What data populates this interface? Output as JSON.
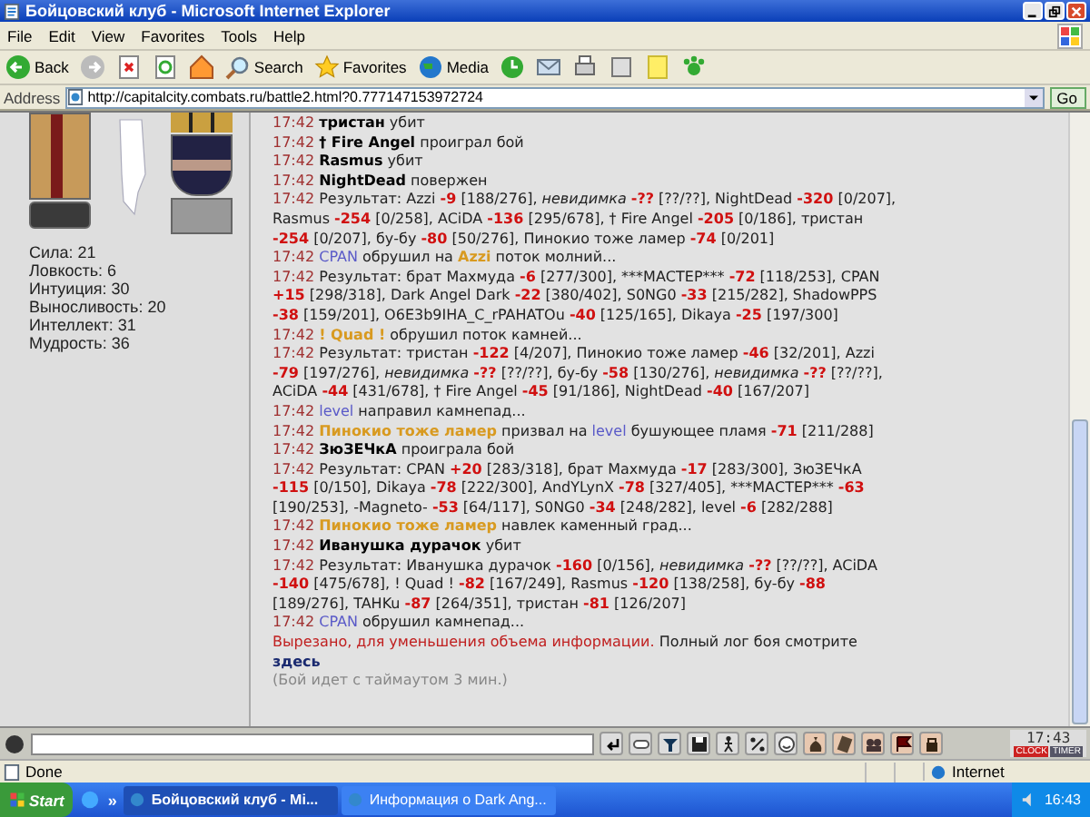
{
  "window": {
    "title": "Бойцовский клуб - Microsoft Internet Explorer"
  },
  "menu": [
    "File",
    "Edit",
    "View",
    "Favorites",
    "Tools",
    "Help"
  ],
  "toolbar": {
    "back": "Back",
    "buttons": [
      {
        "label": "Search",
        "kind": "search"
      },
      {
        "label": "Favorites",
        "kind": "star"
      },
      {
        "label": "Media",
        "kind": "globe"
      }
    ]
  },
  "address": {
    "label": "Address",
    "value": "http://capitalcity.combats.ru/battle2.html?0.777147153972724",
    "go": "Go"
  },
  "character": {
    "stats": [
      "Сила: 21",
      "Ловкость: 6",
      "Интуиция: 30",
      "Выносливость: 20",
      "Интеллект: 31",
      "Мудрость: 36"
    ]
  },
  "log": {
    "entries": [
      {
        "time": "17:42",
        "parts": [
          {
            "kind": "name",
            "text": "тристан"
          },
          {
            "kind": "text",
            "text": " убит"
          }
        ]
      },
      {
        "time": "17:42",
        "parts": [
          {
            "kind": "name",
            "text": "† Fire Angel"
          },
          {
            "kind": "text",
            "text": " проиграл бой"
          }
        ]
      },
      {
        "time": "17:42",
        "parts": [
          {
            "kind": "name",
            "text": "Rasmus"
          },
          {
            "kind": "text",
            "text": " убит"
          }
        ]
      },
      {
        "time": "17:42",
        "parts": [
          {
            "kind": "name",
            "text": "NightDead"
          },
          {
            "kind": "text",
            "text": " повержен"
          }
        ]
      },
      {
        "time": "17:42",
        "parts": [
          {
            "kind": "text",
            "text": "Результат: Azzi "
          },
          {
            "kind": "hit",
            "text": "-9"
          },
          {
            "kind": "text",
            "text": " [188/276], "
          },
          {
            "kind": "italic",
            "text": "невидимка "
          },
          {
            "kind": "hit",
            "text": "-??"
          },
          {
            "kind": "text",
            "text": " [??/??], NightDead "
          },
          {
            "kind": "hit",
            "text": "-320"
          },
          {
            "kind": "text",
            "text": " [0/207], Rasmus "
          },
          {
            "kind": "hit",
            "text": "-254"
          },
          {
            "kind": "text",
            "text": " [0/258], ACiDA "
          },
          {
            "kind": "hit",
            "text": "-136"
          },
          {
            "kind": "text",
            "text": " [295/678], † Fire Angel "
          },
          {
            "kind": "hit",
            "text": "-205"
          },
          {
            "kind": "text",
            "text": " [0/186], тристан "
          },
          {
            "kind": "hit",
            "text": "-254"
          },
          {
            "kind": "text",
            "text": " [0/207], бу-бу "
          },
          {
            "kind": "hit",
            "text": "-80"
          },
          {
            "kind": "text",
            "text": " [50/276], Пинокио тоже ламер "
          },
          {
            "kind": "hit",
            "text": "-74"
          },
          {
            "kind": "text",
            "text": " [0/201]"
          }
        ]
      },
      {
        "time": "17:42",
        "parts": [
          {
            "kind": "team-b",
            "text": "CPAN"
          },
          {
            "kind": "text",
            "text": " обрушил на "
          },
          {
            "kind": "team-a",
            "text": "Azzi"
          },
          {
            "kind": "text",
            "text": " поток молний..."
          }
        ]
      },
      {
        "time": "17:42",
        "parts": [
          {
            "kind": "text",
            "text": "Результат: брат Махмуда "
          },
          {
            "kind": "hit",
            "text": "-6"
          },
          {
            "kind": "text",
            "text": " [277/300], ***МАСТЕР*** "
          },
          {
            "kind": "hit",
            "text": "-72"
          },
          {
            "kind": "text",
            "text": " [118/253], CPAN "
          },
          {
            "kind": "hit",
            "text": "+15"
          },
          {
            "kind": "text",
            "text": " [298/318], Dark Angel Dark "
          },
          {
            "kind": "hit",
            "text": "-22"
          },
          {
            "kind": "text",
            "text": " [380/402], S0NG0 "
          },
          {
            "kind": "hit",
            "text": "-33"
          },
          {
            "kind": "text",
            "text": " [215/282], ShadowPPS "
          },
          {
            "kind": "hit",
            "text": "-38"
          },
          {
            "kind": "text",
            "text": " [159/201], О6Е3b9IHA_C_rPAHATOu "
          },
          {
            "kind": "hit",
            "text": "-40"
          },
          {
            "kind": "text",
            "text": " [125/165], Dikaya "
          },
          {
            "kind": "hit",
            "text": "-25"
          },
          {
            "kind": "text",
            "text": " [197/300]"
          }
        ]
      },
      {
        "time": "17:42",
        "parts": [
          {
            "kind": "team-a",
            "text": "! Quad !"
          },
          {
            "kind": "text",
            "text": " обрушил поток камней..."
          }
        ]
      },
      {
        "time": "17:42",
        "parts": [
          {
            "kind": "text",
            "text": "Результат: тристан "
          },
          {
            "kind": "hit",
            "text": "-122"
          },
          {
            "kind": "text",
            "text": " [4/207], Пинокио тоже ламер "
          },
          {
            "kind": "hit",
            "text": "-46"
          },
          {
            "kind": "text",
            "text": " [32/201], Azzi "
          },
          {
            "kind": "hit",
            "text": "-79"
          },
          {
            "kind": "text",
            "text": " [197/276], "
          },
          {
            "kind": "italic",
            "text": "невидимка "
          },
          {
            "kind": "hit",
            "text": "-??"
          },
          {
            "kind": "text",
            "text": " [??/??], бу-бу "
          },
          {
            "kind": "hit",
            "text": "-58"
          },
          {
            "kind": "text",
            "text": " [130/276], "
          },
          {
            "kind": "italic",
            "text": "невидимка "
          },
          {
            "kind": "hit",
            "text": "-??"
          },
          {
            "kind": "text",
            "text": " [??/??], ACiDA "
          },
          {
            "kind": "hit",
            "text": "-44"
          },
          {
            "kind": "text",
            "text": " [431/678], † Fire Angel "
          },
          {
            "kind": "hit",
            "text": "-45"
          },
          {
            "kind": "text",
            "text": " [91/186], NightDead "
          },
          {
            "kind": "hit",
            "text": "-40"
          },
          {
            "kind": "text",
            "text": " [167/207]"
          }
        ]
      },
      {
        "time": "17:42",
        "parts": [
          {
            "kind": "team-b",
            "text": "level"
          },
          {
            "kind": "text",
            "text": " направил камнепад..."
          }
        ]
      },
      {
        "time": "17:42",
        "parts": [
          {
            "kind": "team-a",
            "text": "Пинокио тоже ламер"
          },
          {
            "kind": "text",
            "text": " призвал на "
          },
          {
            "kind": "team-b",
            "text": "level"
          },
          {
            "kind": "text",
            "text": " бушующее пламя "
          },
          {
            "kind": "hit",
            "text": "-71"
          },
          {
            "kind": "text",
            "text": " [211/288]"
          }
        ]
      },
      {
        "time": "17:42",
        "parts": [
          {
            "kind": "name",
            "text": "ЗюЗЕЧкА"
          },
          {
            "kind": "text",
            "text": " проиграла бой"
          }
        ]
      },
      {
        "time": "17:42",
        "parts": [
          {
            "kind": "text",
            "text": "Результат: CPAN "
          },
          {
            "kind": "hit",
            "text": "+20"
          },
          {
            "kind": "text",
            "text": " [283/318], брат Махмуда "
          },
          {
            "kind": "hit",
            "text": "-17"
          },
          {
            "kind": "text",
            "text": " [283/300], ЗюЗЕЧкА "
          },
          {
            "kind": "hit",
            "text": "-115"
          },
          {
            "kind": "text",
            "text": " [0/150], Dikaya "
          },
          {
            "kind": "hit",
            "text": "-78"
          },
          {
            "kind": "text",
            "text": " [222/300], AndYLynX "
          },
          {
            "kind": "hit",
            "text": "-78"
          },
          {
            "kind": "text",
            "text": " [327/405], ***МАСТЕР*** "
          },
          {
            "kind": "hit",
            "text": "-63"
          },
          {
            "kind": "text",
            "text": " [190/253], -Magneto- "
          },
          {
            "kind": "hit",
            "text": "-53"
          },
          {
            "kind": "text",
            "text": " [64/117], S0NG0 "
          },
          {
            "kind": "hit",
            "text": "-34"
          },
          {
            "kind": "text",
            "text": " [248/282], level "
          },
          {
            "kind": "hit",
            "text": "-6"
          },
          {
            "kind": "text",
            "text": " [282/288]"
          }
        ]
      },
      {
        "time": "17:42",
        "parts": [
          {
            "kind": "team-a",
            "text": "Пинокио тоже ламер"
          },
          {
            "kind": "text",
            "text": " навлек каменный град..."
          }
        ]
      },
      {
        "time": "17:42",
        "parts": [
          {
            "kind": "name",
            "text": "Иванушка дурачок"
          },
          {
            "kind": "text",
            "text": " убит"
          }
        ]
      },
      {
        "time": "17:42",
        "parts": [
          {
            "kind": "text",
            "text": "Результат: Иванушка дурачок "
          },
          {
            "kind": "hit",
            "text": "-160"
          },
          {
            "kind": "text",
            "text": " [0/156], "
          },
          {
            "kind": "italic",
            "text": "невидимка "
          },
          {
            "kind": "hit",
            "text": "-??"
          },
          {
            "kind": "text",
            "text": " [??/??], ACiDA "
          },
          {
            "kind": "hit",
            "text": "-140"
          },
          {
            "kind": "text",
            "text": " [475/678], ! Quad ! "
          },
          {
            "kind": "hit",
            "text": "-82"
          },
          {
            "kind": "text",
            "text": " [167/249], Rasmus "
          },
          {
            "kind": "hit",
            "text": "-120"
          },
          {
            "kind": "text",
            "text": " [138/258], бу-бу "
          },
          {
            "kind": "hit",
            "text": "-88"
          },
          {
            "kind": "text",
            "text": " [189/276], TAHKu "
          },
          {
            "kind": "hit",
            "text": "-87"
          },
          {
            "kind": "text",
            "text": " [264/351], тристан "
          },
          {
            "kind": "hit",
            "text": "-81"
          },
          {
            "kind": "text",
            "text": " [126/207]"
          }
        ]
      },
      {
        "time": "17:42",
        "parts": [
          {
            "kind": "team-b",
            "text": "CPAN"
          },
          {
            "kind": "text",
            "text": " обрушил камнепад..."
          }
        ]
      }
    ],
    "notice": {
      "cut": "Вырезано, для уменьшения объема информации.",
      "rest": " Полный лог боя смотрите ",
      "link": "здесь"
    },
    "timeout": "(Бой идет с таймаутом 3 мин.)"
  },
  "chat_bar": {
    "clock": "17:43",
    "clock_label": "CLOCK",
    "timer_label": "TIMER"
  },
  "status_bar": {
    "text": "Done",
    "zone": "Internet"
  },
  "taskbar": {
    "start": "Start",
    "overflow": "»",
    "tasks": [
      {
        "label": "Бойцовский клуб - Mi...",
        "selected": true
      },
      {
        "label": "Информация о Dark Ang...",
        "selected": false
      }
    ],
    "time": "16:43"
  }
}
